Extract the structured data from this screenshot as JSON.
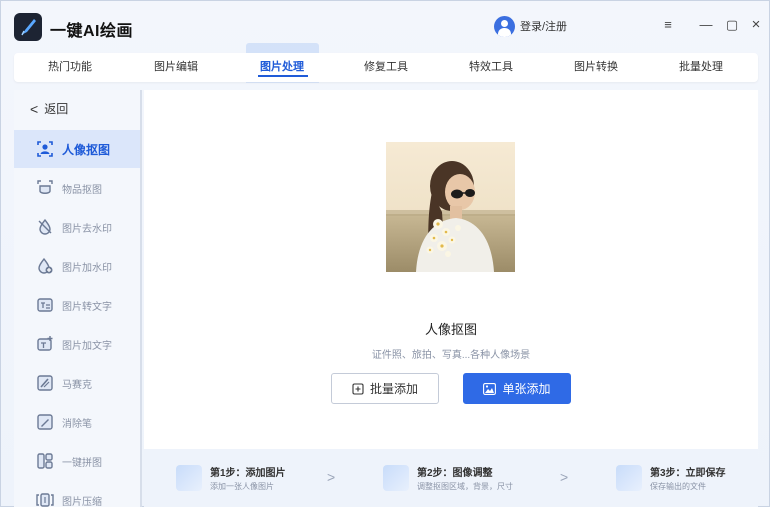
{
  "app": {
    "title": "一键AI绘画"
  },
  "user": {
    "login_label": "登录/注册"
  },
  "window": {
    "menu": "≡",
    "minimize": "—",
    "maximize": "▢",
    "close": "×"
  },
  "tabs": [
    {
      "label": "热门功能",
      "active": false
    },
    {
      "label": "图片编辑",
      "active": false
    },
    {
      "label": "图片处理",
      "active": true
    },
    {
      "label": "修复工具",
      "active": false
    },
    {
      "label": "特效工具",
      "active": false
    },
    {
      "label": "图片转换",
      "active": false
    },
    {
      "label": "批量处理",
      "active": false
    }
  ],
  "sidebar": {
    "back_label": "返回",
    "items": [
      {
        "label": "人像抠图",
        "icon": "portrait-cutout-icon",
        "active": true
      },
      {
        "label": "物品抠图",
        "icon": "object-cutout-icon",
        "active": false
      },
      {
        "label": "图片去水印",
        "icon": "remove-watermark-icon",
        "active": false
      },
      {
        "label": "图片加水印",
        "icon": "add-watermark-icon",
        "active": false
      },
      {
        "label": "图片转文字",
        "icon": "image-to-text-icon",
        "active": false
      },
      {
        "label": "图片加文字",
        "icon": "add-text-icon",
        "active": false
      },
      {
        "label": "马赛克",
        "icon": "mosaic-icon",
        "active": false
      },
      {
        "label": "消除笔",
        "icon": "eraser-pen-icon",
        "active": false
      },
      {
        "label": "一键拼图",
        "icon": "collage-icon",
        "active": false
      },
      {
        "label": "图片压缩",
        "icon": "compress-icon",
        "active": false
      }
    ]
  },
  "main": {
    "feature_title": "人像抠图",
    "feature_desc": "证件照、旅拍、写真...各种人像场景",
    "batch_add_label": "批量添加",
    "single_add_label": "单张添加"
  },
  "steps": [
    {
      "title": "第1步：添加图片",
      "desc": "添加一张人像图片"
    },
    {
      "title": "第2步：图像调整",
      "desc": "调整抠图区域，背景，尺寸"
    },
    {
      "title": "第3步：立即保存",
      "desc": "保存输出的文件"
    }
  ],
  "colors": {
    "accent": "#1f5bd8",
    "primary_button": "#2f6ae6",
    "sidebar_active_bg": "#dbe6fa"
  }
}
